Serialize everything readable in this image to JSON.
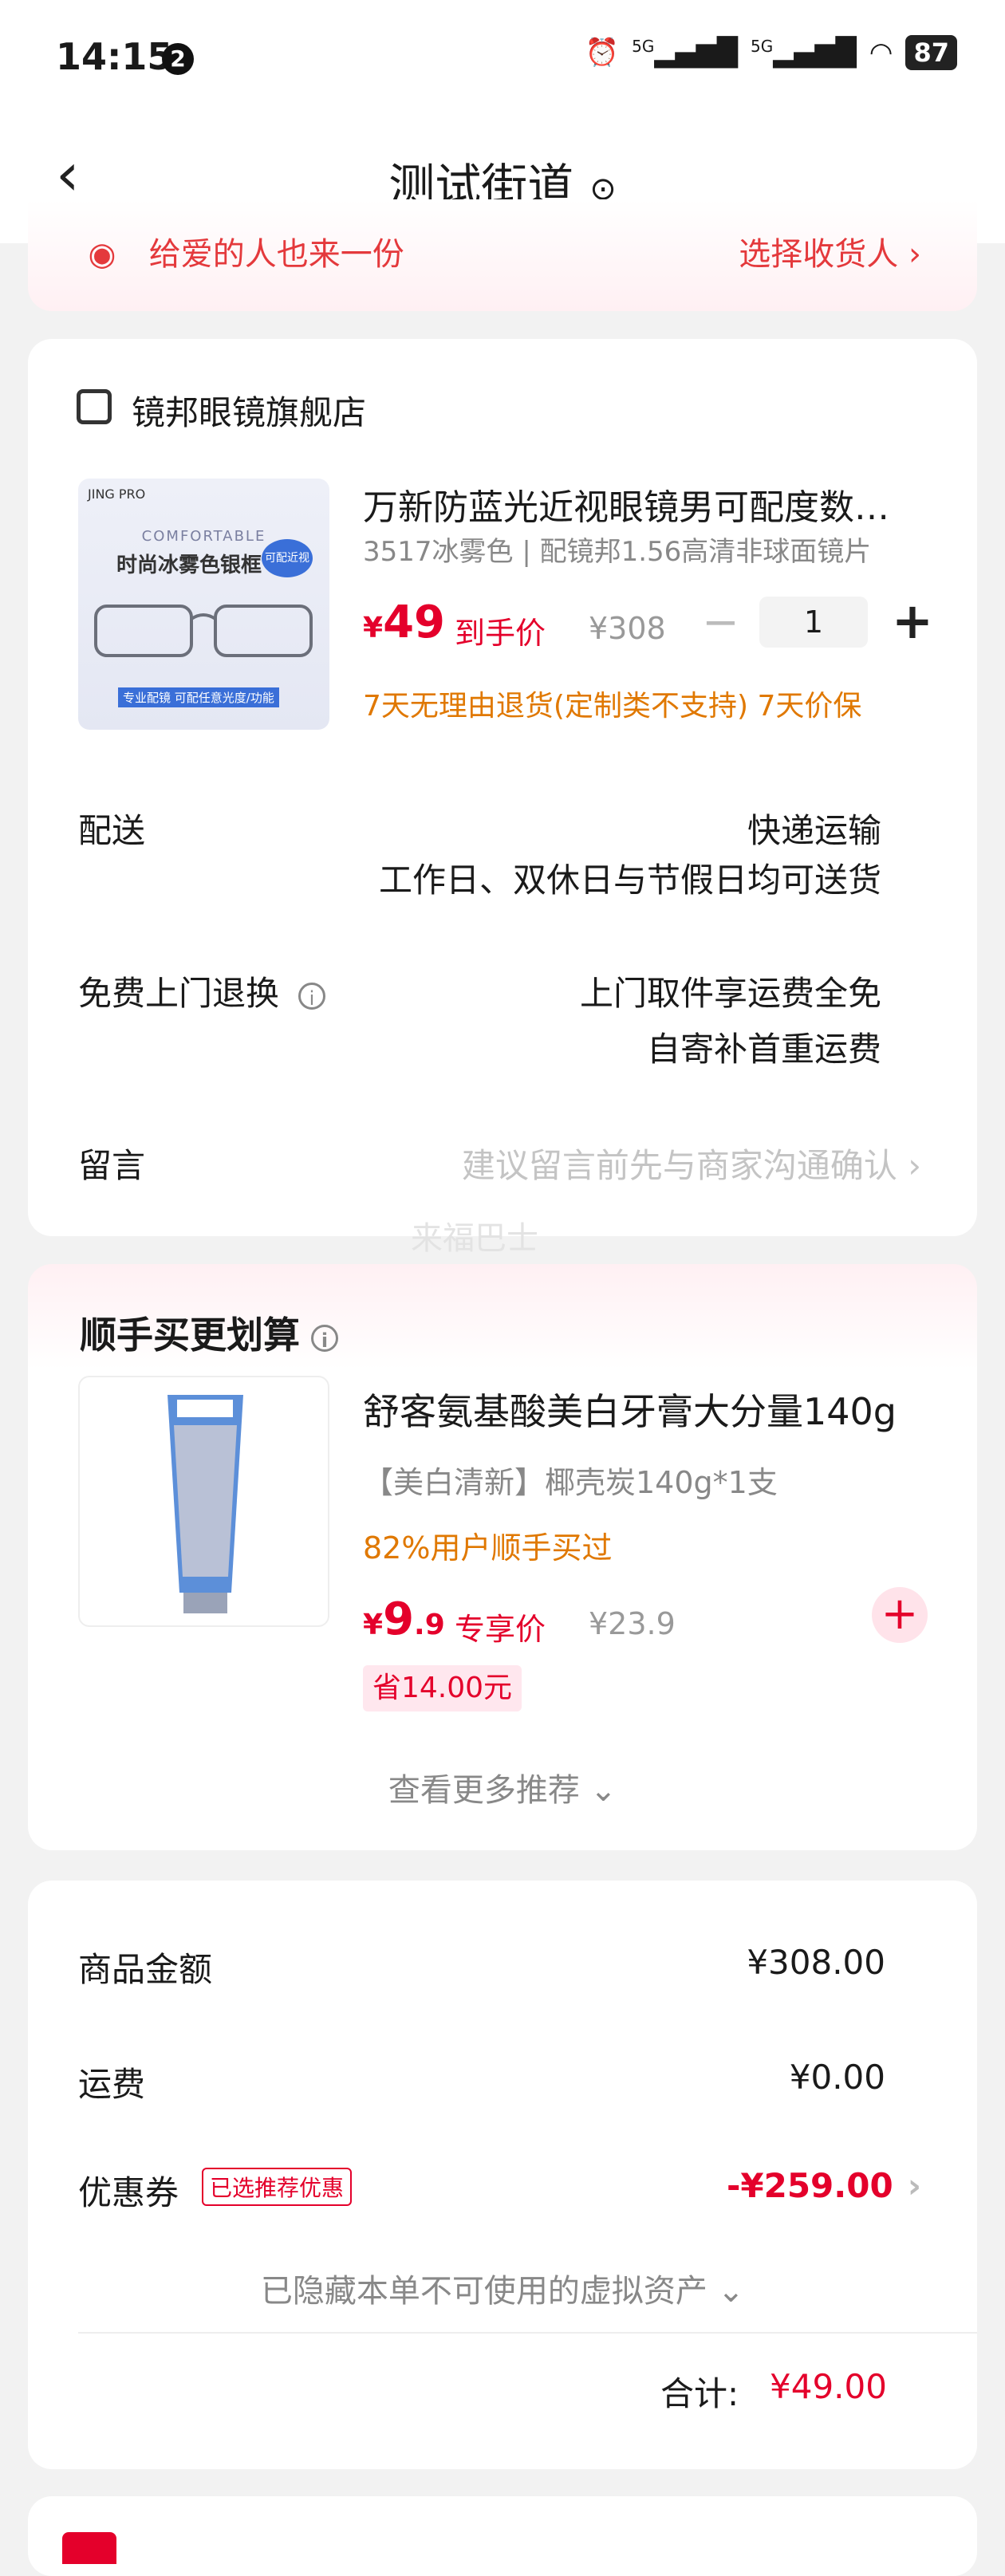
{
  "status_bar": {
    "time": "14:15",
    "badge": "2",
    "network1": "5G",
    "network2": "5G",
    "battery": "87"
  },
  "header": {
    "title": "测试街道"
  },
  "gift_bar": {
    "left_text": "给爱的人也来一份",
    "right_text": "选择收货人 ›"
  },
  "store": {
    "name": "镜邦眼镜旗舰店",
    "product": {
      "image_brand": "JING PRO",
      "image_sub": "COMFORTABLE",
      "image_caption": "时尚冰雾色银框",
      "image_tag": "可配近视",
      "image_bottom": "专业配镜  可配任意光度/功能",
      "title": "万新防蓝光近视眼镜男可配度数镜框",
      "spec": "3517冰雾色 | 配镜邦1.56高清非球面镜片",
      "price_symbol": "¥",
      "price": "49",
      "price_label": "到手价",
      "original_price": "¥308",
      "quantity": "1",
      "policy": "7天无理由退货(定制类不支持)  7天价保"
    },
    "delivery": {
      "label": "配送",
      "line1": "快递运输",
      "line2": "工作日、双休日与节假日均可送货"
    },
    "free_return": {
      "label": "免费上门退换",
      "line1": "上门取件享运费全免",
      "line2": "自寄补首重运费"
    },
    "message": {
      "label": "留言",
      "placeholder": "建议留言前先与商家沟通确认 ›"
    },
    "watermark": "来福巴士"
  },
  "recommend": {
    "title": "顺手买更划算",
    "product": {
      "name": "舒客氨基酸美白牙膏大分量140g",
      "spec": "【美白清新】椰壳炭140g*1支",
      "social": "82%用户顺手买过",
      "price_symbol": "¥",
      "price_int": "9",
      "price_dec": ".9",
      "price_label": "专享价",
      "original_price": "¥23.9",
      "save": "省14.00元"
    },
    "more": "查看更多推荐 ⌄"
  },
  "summary": {
    "goods_label": "商品金额",
    "goods_value": "¥308.00",
    "shipping_label": "运费",
    "shipping_value": "¥0.00",
    "coupon_label": "优惠券",
    "coupon_tag": "已选推荐优惠",
    "coupon_value": "-¥259.00",
    "hidden_assets": "已隐藏本单不可使用的虚拟资产 ⌄",
    "total_label": "合计:",
    "total_value": "¥49.00"
  },
  "colors": {
    "accent": "#e4002b",
    "orange": "#e07800",
    "muted": "#888888",
    "background": "#f2f2f2"
  }
}
